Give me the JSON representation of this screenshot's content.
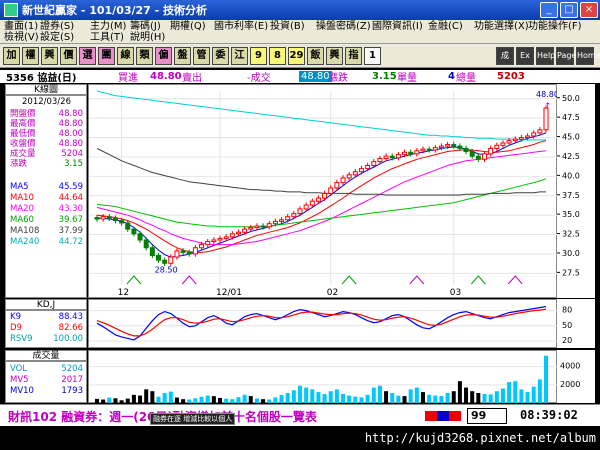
{
  "window": {
    "title": "新世紀贏家 - 101/03/27 - 技術分析",
    "btn_min": "_",
    "btn_max": "□",
    "btn_close": "×"
  },
  "menu": {
    "row1": [
      "畫面(1)",
      "證券(S)",
      "主力(M)",
      "籌碼(J)",
      "期權(Q)",
      "國市利率(E)",
      "投資(B)",
      "操盤密碼(Z)",
      "國際資訊(I)",
      "金融(C)",
      "功能選擇(X)",
      "功能操作(F)"
    ],
    "row2": [
      "檢視(V)",
      "設定(S)",
      "工具(T)",
      "說明(H)"
    ]
  },
  "toolbar": {
    "buttons": [
      "加",
      "權",
      "興",
      "價",
      "選",
      "團",
      "線",
      "類",
      "偏",
      "盤",
      "管",
      "委",
      "江",
      "9",
      "8",
      "29",
      "飯",
      "興",
      "指",
      "1"
    ],
    "right_buttons": [
      "成",
      "Ex",
      "Help",
      "Page",
      "Home"
    ]
  },
  "quote": {
    "stock": "5356 協益(日)",
    "buy_label": "買進",
    "buy_value": "48.80",
    "sell_label": "賣出",
    "trade_label": "-成交",
    "trade_value": "48.80",
    "change_label": "漲跌",
    "change_value": "3.15",
    "unit_label": "單量",
    "unit_value": "4",
    "total_label": "總量",
    "total_value": "5203"
  },
  "kpanel": {
    "title": "K線圖",
    "date": "2012/03/26",
    "rows": [
      {
        "k": "開盤價",
        "v": "48.80"
      },
      {
        "k": "最高價",
        "v": "48.80"
      },
      {
        "k": "最低價",
        "v": "48.00"
      },
      {
        "k": "收盤價",
        "v": "48.80"
      },
      {
        "k": "成交量",
        "v": "5204"
      },
      {
        "k": "漲跌",
        "v": "3.15"
      }
    ],
    "ma": [
      {
        "k": "MA5",
        "v": "45.59"
      },
      {
        "k": "MA10",
        "v": "44.64"
      },
      {
        "k": "MA20",
        "v": "43.30"
      },
      {
        "k": "MA60",
        "v": "39.67"
      },
      {
        "k": "MA108",
        "v": "37.99"
      },
      {
        "k": "MA240",
        "v": "44.72"
      }
    ]
  },
  "kdpanel": {
    "title": "KD,J",
    "rows": [
      {
        "k": "K9",
        "v": "88.43"
      },
      {
        "k": "D9",
        "v": "82.66"
      },
      {
        "k": "RSV9",
        "v": "100.00"
      }
    ]
  },
  "volpanel": {
    "title": "成交量",
    "rows": [
      {
        "k": "VOL",
        "v": "5204"
      },
      {
        "k": "MV5",
        "v": "2017"
      },
      {
        "k": "MV10",
        "v": "1793"
      }
    ]
  },
  "chart_data": [
    {
      "type": "line",
      "title": "",
      "xlabel": "",
      "ylabel": "",
      "ylim": [
        26,
        51
      ],
      "yticks": [
        "50.0",
        "47.5",
        "45.0",
        "42.5",
        "40.0",
        "37.5",
        "35.0",
        "32.5",
        "30.0",
        "27.5"
      ],
      "xticks": [
        "12",
        "12/01",
        "02",
        "03"
      ],
      "annotations": [
        "28.50",
        "48.80"
      ],
      "closes": [
        34.5,
        34.8,
        34.6,
        34.3,
        34.0,
        33.2,
        32.6,
        31.8,
        30.8,
        29.8,
        29.2,
        28.8,
        29.6,
        30.4,
        30.2,
        30.0,
        30.8,
        31.2,
        31.6,
        31.8,
        32.0,
        32.2,
        32.6,
        32.8,
        33.2,
        33.4,
        33.6,
        33.5,
        33.9,
        34.2,
        34.4,
        34.8,
        35.2,
        35.8,
        36.3,
        36.8,
        37.2,
        37.8,
        38.5,
        39.2,
        39.8,
        40.2,
        40.6,
        41.0,
        41.4,
        41.9,
        42.3,
        42.6,
        42.4,
        42.8,
        43.1,
        42.9,
        43.3,
        43.5,
        43.4,
        43.7,
        43.9,
        44.1,
        43.9,
        43.6,
        43.2,
        42.6,
        42.2,
        42.9,
        43.6,
        44.0,
        44.3,
        44.6,
        44.8,
        45.0,
        45.2,
        45.6,
        46.0,
        48.8
      ],
      "series": [
        {
          "name": "MA5",
          "color": "#0000ff",
          "values": [
            34.6,
            34.6,
            34.5,
            34.4,
            34.2,
            33.9,
            33.4,
            32.8,
            32.0,
            31.2,
            30.5,
            29.9,
            29.6,
            29.7,
            29.8,
            30.0,
            30.2,
            30.5,
            30.8,
            31.1,
            31.4,
            31.7,
            32.0,
            32.3,
            32.6,
            32.9,
            33.1,
            33.3,
            33.5,
            33.7,
            33.9,
            34.2,
            34.6,
            35.0,
            35.5,
            36.0,
            36.5,
            37.0,
            37.6,
            38.2,
            38.8,
            39.4,
            39.9,
            40.4,
            40.8,
            41.2,
            41.6,
            42.0,
            42.2,
            42.4,
            42.6,
            42.8,
            43.0,
            43.1,
            43.3,
            43.4,
            43.6,
            43.7,
            43.8,
            43.7,
            43.5,
            43.2,
            42.9,
            42.8,
            42.9,
            43.2,
            43.6,
            44.0,
            44.3,
            44.6,
            44.9,
            45.1,
            45.3,
            45.6
          ]
        },
        {
          "name": "MA10",
          "color": "#ff0000",
          "values": [
            35.0,
            34.9,
            34.8,
            34.7,
            34.5,
            34.3,
            34.0,
            33.6,
            33.2,
            32.7,
            32.2,
            31.7,
            31.2,
            30.8,
            30.5,
            30.3,
            30.2,
            30.2,
            30.3,
            30.5,
            30.7,
            30.9,
            31.2,
            31.5,
            31.8,
            32.1,
            32.4,
            32.6,
            32.8,
            33.0,
            33.2,
            33.4,
            33.7,
            34.0,
            34.4,
            34.8,
            35.2,
            35.7,
            36.2,
            36.7,
            37.2,
            37.8,
            38.3,
            38.8,
            39.3,
            39.8,
            40.2,
            40.6,
            41.0,
            41.3,
            41.6,
            41.9,
            42.2,
            42.4,
            42.6,
            42.8,
            43.0,
            43.2,
            43.3,
            43.4,
            43.4,
            43.4,
            43.3,
            43.2,
            43.1,
            43.1,
            43.2,
            43.3,
            43.5,
            43.7,
            43.9,
            44.1,
            44.4,
            44.6
          ]
        },
        {
          "name": "MA20",
          "color": "#ff00ff",
          "values": [
            36.0,
            35.8,
            35.6,
            35.4,
            35.2,
            35.0,
            34.7,
            34.4,
            34.0,
            33.7,
            33.3,
            33.0,
            32.6,
            32.3,
            32.0,
            31.8,
            31.6,
            31.4,
            31.3,
            31.2,
            31.2,
            31.2,
            31.2,
            31.3,
            31.4,
            31.5,
            31.6,
            31.8,
            32.0,
            32.2,
            32.4,
            32.6,
            32.8,
            33.0,
            33.3,
            33.6,
            33.9,
            34.2,
            34.5,
            34.9,
            35.3,
            35.7,
            36.1,
            36.5,
            36.9,
            37.3,
            37.7,
            38.1,
            38.5,
            38.9,
            39.3,
            39.6,
            39.9,
            40.2,
            40.5,
            40.8,
            41.1,
            41.4,
            41.6,
            41.8,
            42.0,
            42.1,
            42.2,
            42.3,
            42.4,
            42.5,
            42.6,
            42.7,
            42.8,
            42.9,
            43.0,
            43.1,
            43.2,
            43.3
          ]
        },
        {
          "name": "MA60",
          "color": "#00c000",
          "values": [
            36.4,
            36.3,
            36.2,
            36.1,
            35.9,
            35.7,
            35.5,
            35.3,
            35.1,
            34.9,
            34.7,
            34.5,
            34.3,
            34.1,
            34.0,
            33.9,
            33.8,
            33.7,
            33.6,
            33.6,
            33.5,
            33.5,
            33.5,
            33.5,
            33.5,
            33.5,
            33.5,
            33.5,
            33.6,
            33.7,
            33.8,
            33.9,
            34.0,
            34.1,
            34.2,
            34.3,
            34.4,
            34.5,
            34.6,
            34.7,
            34.8,
            34.9,
            35.0,
            35.1,
            35.2,
            35.3,
            35.4,
            35.5,
            35.6,
            35.7,
            35.8,
            35.9,
            36.0,
            36.1,
            36.2,
            36.3,
            36.4,
            36.5,
            36.6,
            36.8,
            37.0,
            37.2,
            37.4,
            37.6,
            37.8,
            38.0,
            38.2,
            38.4,
            38.6,
            38.8,
            39.0,
            39.2,
            39.4,
            39.7
          ]
        },
        {
          "name": "MA108",
          "color": "#404040",
          "values": [
            43.6,
            43.2,
            42.8,
            42.4,
            42.0,
            41.7,
            41.4,
            41.1,
            40.8,
            40.5,
            40.3,
            40.1,
            39.9,
            39.7,
            39.5,
            39.3,
            39.2,
            39.1,
            39.0,
            38.9,
            38.8,
            38.7,
            38.6,
            38.5,
            38.4,
            38.3,
            38.3,
            38.2,
            38.2,
            38.1,
            38.1,
            38.0,
            38.0,
            38.0,
            37.9,
            37.9,
            37.9,
            37.8,
            37.8,
            37.8,
            37.8,
            37.8,
            37.7,
            37.7,
            37.7,
            37.7,
            37.7,
            37.6,
            37.6,
            37.6,
            37.6,
            37.6,
            37.6,
            37.6,
            37.6,
            37.6,
            37.6,
            37.6,
            37.6,
            37.6,
            37.7,
            37.7,
            37.7,
            37.7,
            37.8,
            37.8,
            37.8,
            37.8,
            37.9,
            37.9,
            37.9,
            37.9,
            38.0,
            38.0
          ]
        },
        {
          "name": "MA240",
          "color": "#00d0d0",
          "values": [
            51.0,
            50.8,
            50.6,
            50.4,
            50.3,
            50.2,
            50.1,
            50.0,
            49.9,
            49.8,
            49.7,
            49.6,
            49.5,
            49.4,
            49.3,
            49.2,
            49.1,
            49.0,
            48.9,
            48.8,
            48.7,
            48.6,
            48.5,
            48.4,
            48.3,
            48.2,
            48.1,
            48.0,
            47.9,
            47.8,
            47.7,
            47.6,
            47.5,
            47.4,
            47.3,
            47.2,
            47.1,
            47.0,
            46.9,
            46.8,
            46.7,
            46.6,
            46.5,
            46.4,
            46.3,
            46.2,
            46.1,
            46.0,
            45.9,
            45.8,
            45.7,
            45.6,
            45.5,
            45.4,
            45.3,
            45.3,
            45.2,
            45.2,
            45.1,
            45.1,
            45.0,
            45.0,
            44.9,
            44.9,
            44.9,
            44.8,
            44.8,
            44.8,
            44.8,
            44.7,
            44.7,
            44.7,
            44.7,
            44.7
          ]
        }
      ]
    },
    {
      "type": "line",
      "title": "",
      "ylim": [
        10,
        95
      ],
      "yticks": [
        "80",
        "50",
        "20"
      ],
      "series": [
        {
          "name": "K9",
          "color": "#0000ff",
          "values": [
            55,
            48,
            40,
            32,
            28,
            25,
            22,
            30,
            45,
            60,
            72,
            78,
            74,
            65,
            55,
            48,
            50,
            58,
            66,
            70,
            64,
            55,
            52,
            60,
            68,
            72,
            74,
            70,
            66,
            62,
            66,
            72,
            78,
            82,
            80,
            76,
            72,
            68,
            70,
            74,
            78,
            76,
            72,
            66,
            60,
            56,
            58,
            64,
            70,
            72,
            68,
            60,
            52,
            46,
            44,
            50,
            58,
            66,
            72,
            76,
            78,
            74,
            70,
            66,
            64,
            68,
            72,
            76,
            78,
            80,
            82,
            84,
            86,
            88
          ]
        },
        {
          "name": "D9",
          "color": "#ff0000",
          "values": [
            60,
            56,
            51,
            45,
            39,
            34,
            30,
            30,
            35,
            43,
            53,
            62,
            66,
            66,
            62,
            57,
            55,
            56,
            59,
            63,
            64,
            61,
            58,
            59,
            62,
            66,
            69,
            70,
            69,
            66,
            66,
            68,
            71,
            75,
            77,
            77,
            75,
            73,
            72,
            72,
            74,
            75,
            74,
            71,
            67,
            63,
            61,
            62,
            65,
            67,
            68,
            65,
            61,
            56,
            52,
            51,
            53,
            58,
            63,
            68,
            71,
            72,
            71,
            69,
            67,
            67,
            69,
            71,
            74,
            76,
            78,
            80,
            81,
            83
          ]
        }
      ]
    },
    {
      "type": "bar",
      "title": "",
      "ylim": [
        0,
        5500
      ],
      "yticks": [
        "4000",
        "2000"
      ],
      "values": [
        450,
        380,
        600,
        520,
        300,
        480,
        900,
        820,
        1500,
        1300,
        700,
        1100,
        1250,
        600,
        420,
        380,
        520,
        680,
        820,
        750,
        560,
        480,
        420,
        640,
        900,
        760,
        500,
        420,
        380,
        620,
        880,
        1100,
        1400,
        1900,
        1700,
        1500,
        1200,
        980,
        1300,
        1500,
        1000,
        820,
        700,
        620,
        900,
        1700,
        1900,
        1300,
        1100,
        800,
        760,
        1500,
        1700,
        1200,
        900,
        820,
        760,
        1100,
        1300,
        2400,
        1700,
        1300,
        1100,
        1000,
        950,
        1300,
        1600,
        2300,
        2400,
        1500,
        1200,
        1800,
        2600,
        5204
      ],
      "up": [
        false,
        false,
        true,
        false,
        false,
        false,
        false,
        false,
        false,
        false,
        true,
        true,
        true,
        false,
        false,
        true,
        true,
        true,
        true,
        false,
        false,
        true,
        true,
        true,
        true,
        false,
        true,
        false,
        true,
        true,
        true,
        true,
        true,
        true,
        true,
        true,
        true,
        true,
        true,
        true,
        true,
        true,
        true,
        true,
        true,
        true,
        true,
        false,
        true,
        true,
        false,
        true,
        true,
        false,
        true,
        true,
        true,
        true,
        false,
        false,
        false,
        false,
        false,
        true,
        true,
        true,
        true,
        true,
        true,
        true,
        true,
        true,
        true,
        true
      ]
    }
  ],
  "status": {
    "ticker": "財訊102  融資券：週一(26日)融資增加前十名個股一覽表",
    "tooltip": "融券在逐 增減比較以個人",
    "counter": "99",
    "clock": "08:39:02"
  },
  "url": "http://kujd3268.pixnet.net/album",
  "colors": {
    "up": "#ff0000",
    "down": "#008000",
    "marker": "#c000c0",
    "volume_up": "#00c8ff"
  }
}
